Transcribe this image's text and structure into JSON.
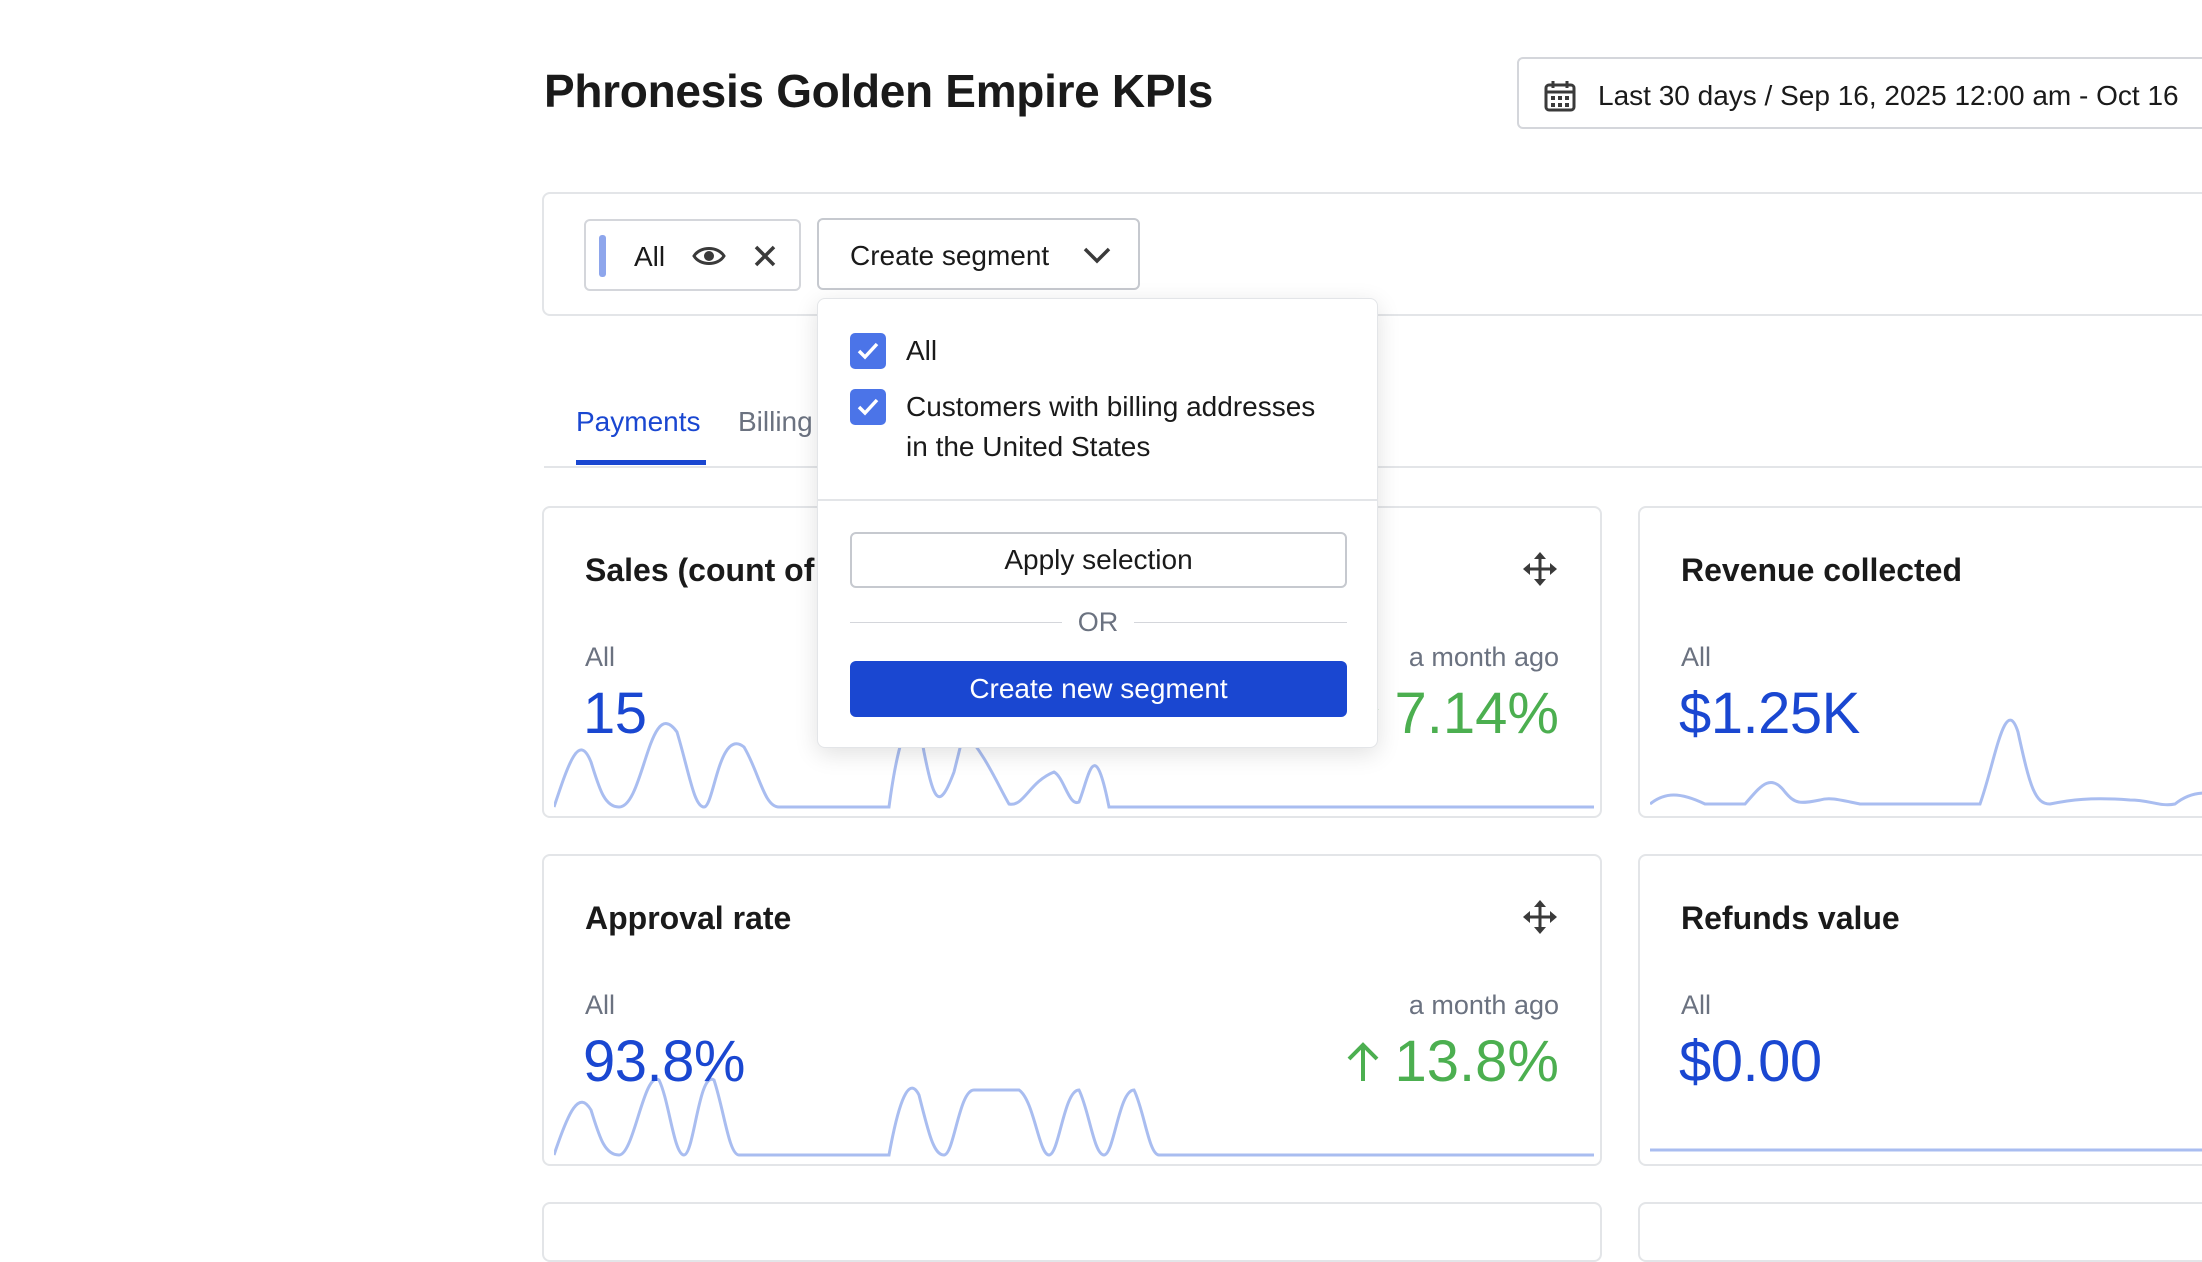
{
  "header": {
    "title": "Phronesis Golden Empire KPIs",
    "date_range": "Last 30 days / Sep 16, 2025 12:00 am - Oct 16"
  },
  "segments": {
    "active_chip": "All",
    "create_label": "Create segment"
  },
  "tabs": [
    {
      "label": "Payments",
      "active": true
    },
    {
      "label": "Billing",
      "active": false
    }
  ],
  "dropdown": {
    "options": [
      {
        "label": "All",
        "checked": true
      },
      {
        "label_line1": "Customers with billing addresses",
        "label_line2": "in the United States",
        "checked": true
      }
    ],
    "apply_label": "Apply selection",
    "or_label": "OR",
    "create_new_label": "Create new segment"
  },
  "cards": [
    {
      "title": "Sales (count of",
      "segment": "All",
      "value": "15",
      "compare_label": "a month ago",
      "delta": "7.14%"
    },
    {
      "title": "Revenue collected",
      "segment": "All",
      "value": "$1.25K"
    },
    {
      "title": "Approval rate",
      "segment": "All",
      "value": "93.8%",
      "compare_label": "a month ago",
      "delta": "13.8%"
    },
    {
      "title": "Refunds value",
      "segment": "All",
      "value": "$0.00"
    }
  ],
  "colors": {
    "accent": "#1a47d1",
    "positive": "#4caf50",
    "sparkline": "#a9bdf0",
    "checkbox": "#4b74e8"
  }
}
